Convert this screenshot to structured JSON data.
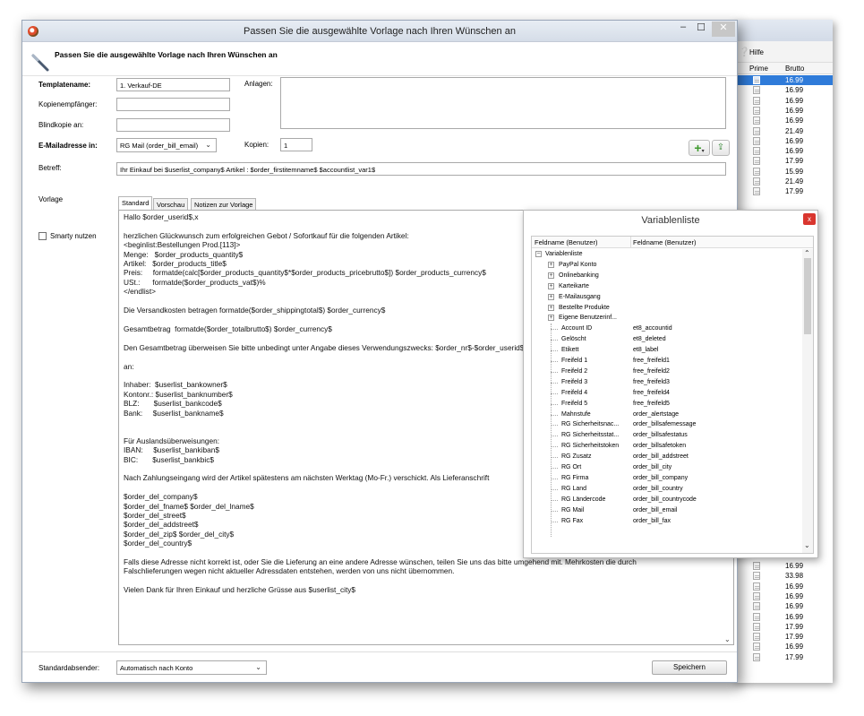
{
  "dialog": {
    "title": "Passen Sie die ausgewählte Vorlage nach Ihren Wünschen an",
    "header": "Passen Sie die ausgewählte Vorlage nach Ihren Wünschen an",
    "controls": {
      "minimize": "–",
      "maximize": "☐",
      "close": "✕"
    }
  },
  "form": {
    "template_name_label": "Templatename:",
    "template_name_value": "1. Verkauf-DE",
    "attachments_label": "Anlagen:",
    "cc_label": "Kopienempfänger:",
    "bcc_label": "Blindkopie an:",
    "email_label": "E-Mailadresse in:",
    "email_value": "RG Mail (order_bill_email)",
    "copies_label": "Kopien:",
    "copies_value": "1",
    "subject_label": "Betreff:",
    "subject_value": "Ihr Einkauf bei $userlist_company$ Artikel : $order_firstitemname$ $accountlist_var1$",
    "template_label": "Vorlage",
    "smarty_label": "Smarty nutzen",
    "sender_label": "Standardabsender:",
    "sender_value": "Automatisch nach Konto",
    "save_label": "Speichern"
  },
  "tabs": [
    "Standard",
    "Vorschau",
    "Notizen zur Vorlage"
  ],
  "editor_text": "Hallo $order_userid$,x\n\nherzlichen Glückwunsch zum erfolgreichen Gebot / Sofortkauf für die folgenden Artikel:\n<beginlist:Bestellungen Prod.[113]>\nMenge:   $order_products_quantity$\nArtikel:   $order_products_title$\nPreis:     formatde(calc[$order_products_quantity$*$order_products_pricebrutto$]) $order_products_currency$\nUSt.:      formatde($order_products_vat$)%\n</endlist>\n\nDie Versandkosten betragen formatde($order_shippingtotal$) $order_currency$\n\nGesamtbetrag  formatde($order_totalbrutto$) $order_currency$\n\nDen Gesamtbetrag überweisen Sie bitte unbedingt unter Angabe dieses Verwendungszwecks: $order_nr$-$order_userid$\n\nan:\n\nInhaber:  $userlist_bankowner$\nKontonr.: $userlist_banknumber$\nBLZ:       $userlist_bankcode$\nBank:     $userlist_bankname$\n\n\nFür Auslandsüberweisungen:\nIBAN:     $userlist_bankiban$\nBIC:       $userlist_bankbic$\n\nNach Zahlungseingang wird der Artikel spätestens am nächsten Werktag (Mo-Fr.) verschickt. Als Lieferanschrift\n\n$order_del_company$\n$order_del_fname$ $order_del_lname$\n$order_del_street$\n$order_del_addstreet$\n$order_del_zip$ $order_del_city$\n$order_del_country$\n\nFalls diese Adresse nicht korrekt ist, oder Sie die Lieferung an eine andere Adresse wünschen, teilen Sie uns das bitte umgehend mit. Mehrkosten die durch\nFalschlieferungen wegen nicht aktueller Adressdaten entstehen, werden von uns nicht übernommen.\n\nVielen Dank für Ihren Einkauf und herzliche Grüsse aus $userlist_city$",
  "variables": {
    "title": "Variablenliste",
    "close": "x",
    "col1": "Feldname (Benutzer)",
    "col2": "Feldname (Benutzer)",
    "root": "Variablenliste",
    "groups": [
      "PayPal Konto",
      "Onlinebanking",
      "Karteikarte",
      "E-Mailausgang",
      "Bestellte Produkte",
      "Eigene Benutzerinf..."
    ],
    "items": [
      {
        "name": "Account ID",
        "field": "et8_accountid"
      },
      {
        "name": "Gelöscht",
        "field": "et8_deleted"
      },
      {
        "name": "Etikett",
        "field": "et8_label"
      },
      {
        "name": "Freifeld 1",
        "field": "free_freifeld1"
      },
      {
        "name": "Freifeld 2",
        "field": "free_freifeld2"
      },
      {
        "name": "Freifeld 3",
        "field": "free_freifeld3"
      },
      {
        "name": "Freifeld 4",
        "field": "free_freifeld4"
      },
      {
        "name": "Freifeld 5",
        "field": "free_freifeld5"
      },
      {
        "name": "Mahnstufe",
        "field": "order_alertstage"
      },
      {
        "name": "RG Sicherheitsnac...",
        "field": "order_billsafemessage"
      },
      {
        "name": "RG Sicherheitsstat...",
        "field": "order_billsafestatus"
      },
      {
        "name": "RG Sicherheitstoken",
        "field": "order_billsafetoken"
      },
      {
        "name": "RG Zusatz",
        "field": "order_bill_addstreet"
      },
      {
        "name": "RG Ort",
        "field": "order_bill_city"
      },
      {
        "name": "RG Firma",
        "field": "order_bill_company"
      },
      {
        "name": "RG Land",
        "field": "order_bill_country"
      },
      {
        "name": "RG Ländercode",
        "field": "order_bill_countrycode"
      },
      {
        "name": "RG Mail",
        "field": "order_bill_email"
      },
      {
        "name": "RG Fax",
        "field": "order_bill_fax"
      }
    ]
  },
  "background_window": {
    "menu_label": "Hilfe",
    "col_prime": "Prime",
    "col_brutto": "Brutto",
    "rows_top": [
      "16.99",
      "16.99",
      "16.99",
      "16.99",
      "16.99",
      "21.49",
      "16.99",
      "16.99",
      "17.99",
      "15.99",
      "21.49",
      "17.99"
    ],
    "rows_bottom": [
      "16.99",
      "33.98",
      "16.99",
      "16.99",
      "16.99",
      "16.99",
      "17.99",
      "17.99",
      "16.99",
      "17.99"
    ]
  },
  "colors": {
    "selection": "#2f7bd9",
    "close": "#d9362f",
    "accent_green": "#3d9a2c"
  }
}
